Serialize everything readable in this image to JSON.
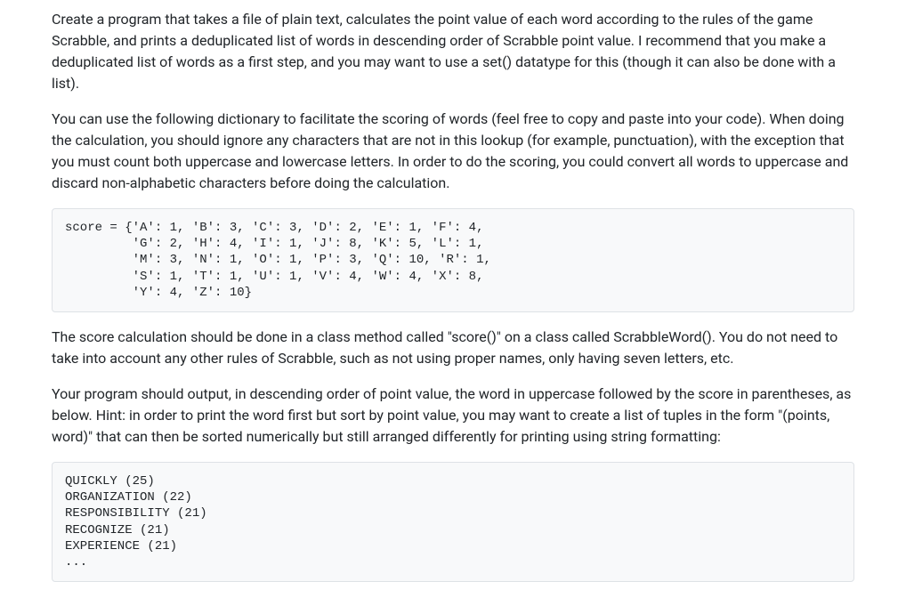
{
  "paragraphs": {
    "p1": "Create a program that takes a file of plain text, calculates the point value of each word according to the rules of the game Scrabble, and prints a deduplicated list of words in descending order of Scrabble point value.  I recommend that you make a deduplicated list of words as a first step, and you may want to use a set() datatype for this (though it can also be done with a list).",
    "p2": "You can use the following dictionary to facilitate the scoring of words (feel free to copy and paste into your code). When doing the calculation, you should ignore any characters that are not in this lookup (for example, punctuation), with the exception that you must count both uppercase and lowercase letters. In order to do the scoring, you could convert all words to uppercase and discard non-alphabetic characters before doing the calculation.",
    "p3": "The score calculation should be done in a class method called \"score()\" on a class called ScrabbleWord(). You do not need to take into account any other rules of Scrabble, such as not using proper names, only having seven letters, etc.",
    "p4": "Your program should output, in descending order of point value, the word in uppercase followed by the score in parentheses, as below.  Hint: in order to print the word first but sort by point value, you may want to create a list of tuples in the form \"(points, word)\" that can then be sorted numerically but still arranged differently for printing using string formatting:"
  },
  "code_blocks": {
    "score_dict": "score = {'A': 1, 'B': 3, 'C': 3, 'D': 2, 'E': 1, 'F': 4,\n         'G': 2, 'H': 4, 'I': 1, 'J': 8, 'K': 5, 'L': 1,\n         'M': 3, 'N': 1, 'O': 1, 'P': 3, 'Q': 10, 'R': 1,\n         'S': 1, 'T': 1, 'U': 1, 'V': 4, 'W': 4, 'X': 8,\n         'Y': 4, 'Z': 10}",
    "output_example": "QUICKLY (25)\nORGANIZATION (22)\nRESPONSIBILITY (21)\nRECOGNIZE (21)\nEXPERIENCE (21)\n..."
  }
}
